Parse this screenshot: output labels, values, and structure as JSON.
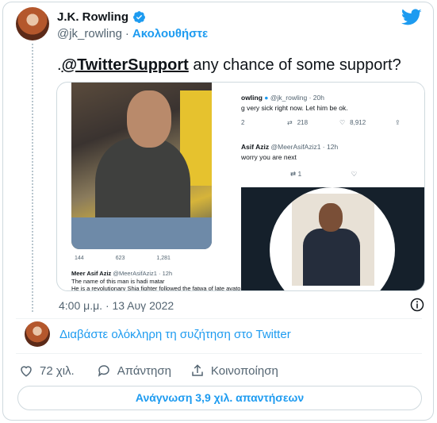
{
  "author": {
    "display_name": "J.K. Rowling",
    "handle": "@jk_rowling",
    "separator": "·",
    "follow": "Ακολουθήστε"
  },
  "tweet": {
    "prefix": ".",
    "mention": "@TwitterSupport",
    "text": " any chance of some support?",
    "timestamp": "4:00 μ.μ. · 13 Αυγ 2022"
  },
  "media": {
    "left_stats": [
      "144",
      "623",
      "1,281"
    ],
    "left_reply_name": "Meer Asif Aziz",
    "left_reply_handle": "@MeerAsifAziz1 · 12h",
    "left_reply_line1": "The name of this man is hadi matar",
    "left_reply_line2": "He is a revolutionary Shia fighter followed the fatwa of late ayatollah",
    "right_top_name": "owling",
    "right_top_handle": "@jk_rowling · 20h",
    "right_top_text": "g very sick right now. Let him be ok.",
    "right_stats": [
      "2",
      "218",
      "8,912"
    ],
    "right_reply_name": "Asif Aziz",
    "right_reply_handle": "@MeerAsifAziz1 · 12h",
    "right_reply_text": "worry you are next",
    "right_reply_retweets": "1"
  },
  "read_conversation": "Διαβάστε ολόκληρη τη συζήτηση στο Twitter",
  "actions": {
    "likes": "72 χιλ.",
    "reply": "Απάντηση",
    "share": "Κοινοποίηση"
  },
  "read_replies": "Ανάγνωση 3,9 χιλ. απαντήσεων",
  "colors": {
    "accent": "#1d9bf0",
    "text": "#0f1419",
    "muted": "#536471",
    "border": "#cfd9de"
  }
}
